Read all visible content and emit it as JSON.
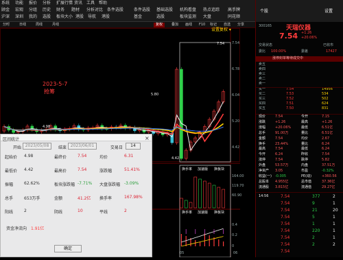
{
  "menu": {
    "items": [
      "系统",
      "功能",
      "报价",
      "分析",
      "扩展行情",
      "资讯",
      "工具",
      "帮助",
      "个股",
      "板块",
      "自选",
      "股",
      "分析师说",
      "条件选股",
      "沪深",
      "深圳",
      "我的",
      "选股",
      "机构看盘",
      "热点追踪",
      "高手",
      "主题",
      "基础选股",
      "集合选股",
      "板块监测",
      "大盘",
      "同花顺问财",
      "人气",
      "实时",
      "机构看盘",
      "热点追踪",
      "港股",
      "美股",
      "全球",
      "期货",
      "期权",
      "资金",
      "公募",
      "场外",
      "研报",
      "资讯",
      "沪深京",
      "港股",
      "美股",
      "量化",
      "收藏"
    ],
    "row1": [
      "系统",
      "功能",
      "报价",
      "分析",
      "扩展行情",
      "资讯",
      "工具",
      "帮助"
    ],
    "row2": [
      "顾金",
      "宏观",
      "分组",
      "历史",
      "财务",
      "题材",
      "分析对比",
      "条件选股"
    ],
    "row3": [
      "沪深",
      "深圳",
      "我的",
      "选股",
      "板块大小",
      "港股",
      "导航",
      "港股"
    ],
    "right_row1": [
      "机构看盘",
      "热点追踪",
      "高手牌",
      "机构精选"
    ],
    "right_row2": [
      "板块监测",
      "大盘",
      "同花顺",
      "专家"
    ],
    "right_row3": [
      "热牌看盘",
      "牛股",
      "自选",
      "港股"
    ],
    "mid_row1": [
      "条件选股",
      "基础选股"
    ],
    "mid_row2": [
      "基金",
      "选股"
    ],
    "mid_row3": [
      "自选",
      "股票"
    ]
  },
  "toolbar": {
    "items": [
      "分时",
      "日线",
      "周线",
      "月线",
      "复权",
      "叠加",
      "画线",
      "F10",
      "标记",
      "自选",
      "分享",
      "模拟交易"
    ],
    "active": "复权"
  },
  "chart": {
    "annotation_date": "2023-5-7",
    "annotation_text": "抢筹",
    "high_label": "7.54",
    "mid_label": "5.80",
    "low_label": "4.42",
    "prev_label": "4.98",
    "right_axis": [
      "7.54",
      "6.78",
      "6.04",
      "5.20",
      "4.42"
    ],
    "top_right_label": "设置复权 ▾",
    "sub_tabs": [
      "换手率",
      "加速版",
      "换板块"
    ],
    "sub_values": [
      "164.00",
      "119.70",
      "60.90",
      "20"
    ],
    "sub2_tabs": [
      "换手率",
      "加速版",
      "换板块"
    ],
    "bottom_labels": [
      "05",
      "06"
    ],
    "macd_axis": [
      "0.4",
      "0.2",
      "0",
      "-0.20"
    ]
  },
  "chart_data": {
    "type": "candlestick",
    "title": "",
    "note": "K线走势与成交量"
  },
  "dialog": {
    "title": "区间统计",
    "start_label": "开始",
    "start_date": "2023/05/08",
    "end_label": "结束",
    "end_date": "2023/06/01",
    "count_label": "交易日",
    "count_value": "14",
    "rows": [
      {
        "l1": "起始价",
        "v1": "4.98",
        "l2": "最终价",
        "v2": "7.54",
        "l3": "均价",
        "v3": "6.31"
      },
      {
        "l1": "最低价",
        "v1": "4.42",
        "l2": "最高价",
        "v2": "7.54",
        "l3": "涨跌幅",
        "v3": "51.41%"
      },
      {
        "l1": "振幅",
        "v1": "62.62%",
        "l2": "板块涨跌幅",
        "v2": "-7.71%",
        "l3": "大盘涨跌幅",
        "v3": "-3.09%"
      },
      {
        "l1": "总手",
        "v1": "653万手",
        "l2": "金额",
        "v2": "41.2亿",
        "l3": "换手率",
        "v3": "167.98%"
      },
      {
        "l1": "阳线",
        "v1": "2",
        "l2": "阴线",
        "v2": "10",
        "l3": "平线",
        "v3": "2"
      }
    ],
    "net_label": "资金净流向",
    "net_value": "1.91亿",
    "ok_label": "确定"
  },
  "quote": {
    "tab_left": "个股",
    "tab_right": "设置",
    "code": "300165",
    "name": "天瑞仪器",
    "price": "7.54",
    "change": "+1.26",
    "change_pct": "+20.06%",
    "status_label": "交易状态",
    "status_value": "已收市",
    "ratio_label": "委比",
    "ratio_value": "100.00%",
    "diff_label": "委差",
    "diff_value": "17427",
    "banner": "涨停封单等待成交中",
    "sell": [
      {
        "label": "卖五",
        "price": "",
        "vol": ""
      },
      {
        "label": "卖四",
        "price": "",
        "vol": ""
      },
      {
        "label": "卖三",
        "price": "",
        "vol": ""
      },
      {
        "label": "卖二",
        "price": "",
        "vol": ""
      },
      {
        "label": "卖一",
        "price": "",
        "vol": ""
      }
    ],
    "buy": [
      {
        "label": "买一",
        "price": "7.54",
        "vol": "14956"
      },
      {
        "label": "买二",
        "price": "7.53",
        "vol": "534"
      },
      {
        "label": "买三",
        "price": "7.52",
        "vol": "502"
      },
      {
        "label": "买四",
        "price": "7.51",
        "vol": "624"
      },
      {
        "label": "买五",
        "price": "7.50",
        "vol": "831"
      }
    ],
    "stats": [
      {
        "l1": "现价",
        "v1": "7.54",
        "l2": "今开",
        "v2": "7.15"
      },
      {
        "l1": "涨跌",
        "v1": "+1.26",
        "l2": "最高",
        "v2": "+1.26"
      },
      {
        "l1": "涨幅",
        "v1": "+20.06%",
        "l2": "最低",
        "v2": "6.51亿"
      },
      {
        "l1": "总手",
        "v1": "91.00万",
        "l2": "量比",
        "v2": "6.51亿"
      },
      {
        "l1": "金额",
        "v1": "7.54",
        "l2": "均价",
        "v2": "2.67"
      },
      {
        "l1": "换手",
        "v1": "23.44%",
        "l2": "量比",
        "v2": "6.24"
      },
      {
        "l1": "最高",
        "v1": "7.54",
        "l2": "最低",
        "v2": "6.24"
      },
      {
        "l1": "今开",
        "v1": "6.24",
        "l2": "昨收",
        "v2": "7.54"
      },
      {
        "l1": "涨停",
        "v1": "7.54",
        "l2": "跌停",
        "v2": "5.82"
      },
      {
        "l1": "外盘",
        "v1": "53.57万",
        "l2": "内盘",
        "v2": "37.51万"
      },
      {
        "l1": "净资产",
        "v1": "3.05",
        "l2": "市盈",
        "v2": "-0.32%"
      },
      {
        "l1": "收益(一)",
        "v1": "-0.005",
        "l2": "PE(动)",
        "v2": "+360.56"
      },
      {
        "l1": "总股本",
        "v1": "4.955亿",
        "l2": "总市值",
        "v2": "37.36亿"
      },
      {
        "l1": "流通股",
        "v1": "3.815亿",
        "l2": "流通值",
        "v2": "29.27亿"
      }
    ],
    "ticks": [
      {
        "time": "14:56",
        "price": "7.54",
        "vol": "377",
        "n": "2"
      },
      {
        "time": "",
        "price": "7.54",
        "vol": "9",
        "n": "1"
      },
      {
        "time": "",
        "price": "7.54",
        "vol": "21",
        "n": "20"
      },
      {
        "time": "",
        "price": "7.54",
        "vol": "5",
        "n": "1"
      },
      {
        "time": "",
        "price": "7.54",
        "vol": "1",
        "n": "1"
      },
      {
        "time": "",
        "price": "7.54",
        "vol": "220",
        "n": "1"
      },
      {
        "time": "",
        "price": "7.54",
        "vol": "2",
        "n": "1"
      },
      {
        "time": "",
        "price": "7.54",
        "vol": "2",
        "n": "2"
      },
      {
        "time": "",
        "price": "7.54",
        "vol": "",
        "n": ""
      }
    ]
  },
  "colors": {
    "up": "#ff3b3b",
    "down": "#2fd14a",
    "ma_yellow": "#ffd400",
    "ma_white": "#f2f2f2",
    "ma_blue": "#3a7bff",
    "bg": "#000000"
  }
}
